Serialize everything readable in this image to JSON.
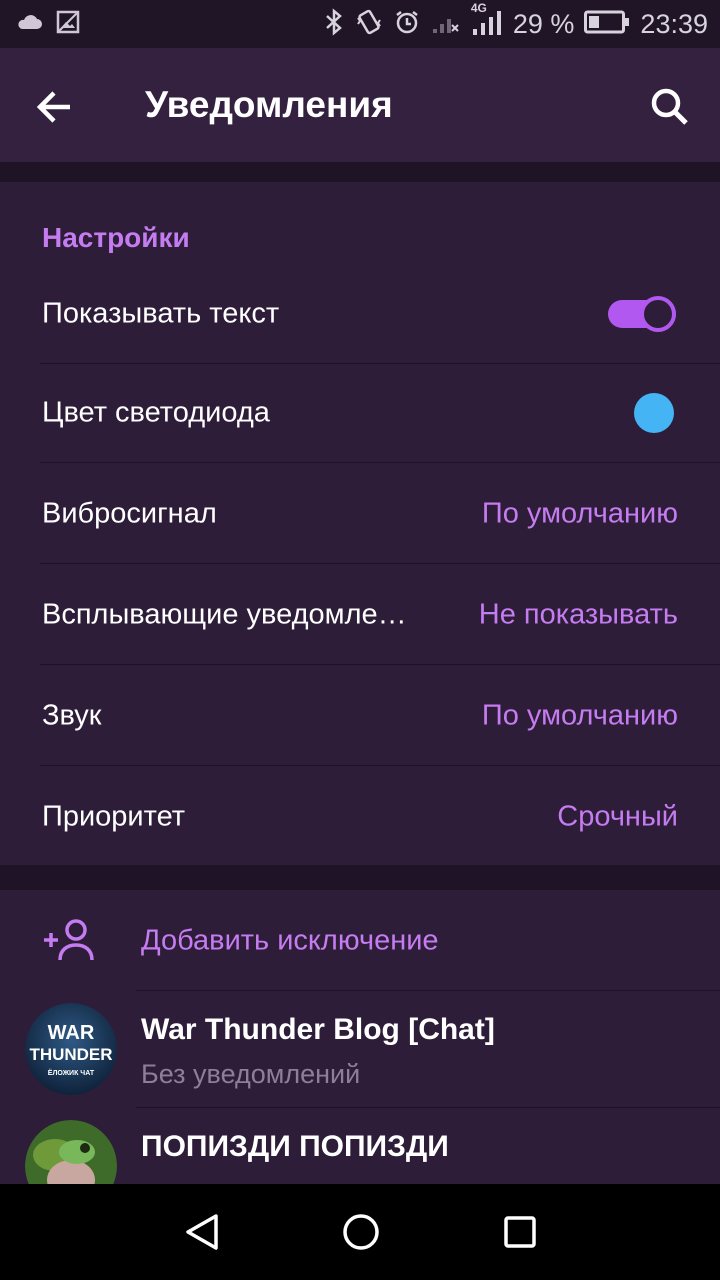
{
  "status_bar": {
    "battery_percent": "29 %",
    "network_type": "4G",
    "time": "23:39",
    "icons": [
      "cloud-icon",
      "image-icon",
      "bluetooth-icon",
      "vibrate-icon",
      "alarm-icon",
      "signal-off-icon",
      "signal-icon",
      "battery-icon"
    ]
  },
  "app_bar": {
    "title": "Уведомления",
    "back_icon": "arrow-back-icon",
    "search_icon": "search-icon"
  },
  "settings": {
    "section_title": "Настройки",
    "rows": [
      {
        "label": "Показывать текст",
        "control": "toggle",
        "checked": true
      },
      {
        "label": "Цвет светодиода",
        "control": "color",
        "color": "#45b4f5"
      },
      {
        "label": "Вибросигнал",
        "value": "По умолчанию"
      },
      {
        "label": "Всплывающие уведомле…",
        "value": "Не показывать"
      },
      {
        "label": "Звук",
        "value": "По умолчанию"
      },
      {
        "label": "Приоритет",
        "value": "Срочный"
      }
    ]
  },
  "exceptions": {
    "add_label": "Добавить исключение",
    "add_icon": "add-user-icon",
    "chats": [
      {
        "name": "War Thunder Blog [Chat]",
        "status": "Без уведомлений",
        "avatar_text": [
          "WAR",
          "THUNDER",
          "ЁЛОЖИК ЧАТ"
        ]
      },
      {
        "name": "ПОПИЗДИ ПОПИЗДИ"
      }
    ]
  },
  "colors": {
    "accent": "#c57cf0",
    "toggle_on": "#b158f0",
    "app_bar": "#33213f",
    "card": "#2d1d39",
    "background": "#1e1426"
  },
  "nav_bar": {
    "icons": [
      "back-triangle-icon",
      "home-circle-icon",
      "recents-square-icon"
    ]
  }
}
